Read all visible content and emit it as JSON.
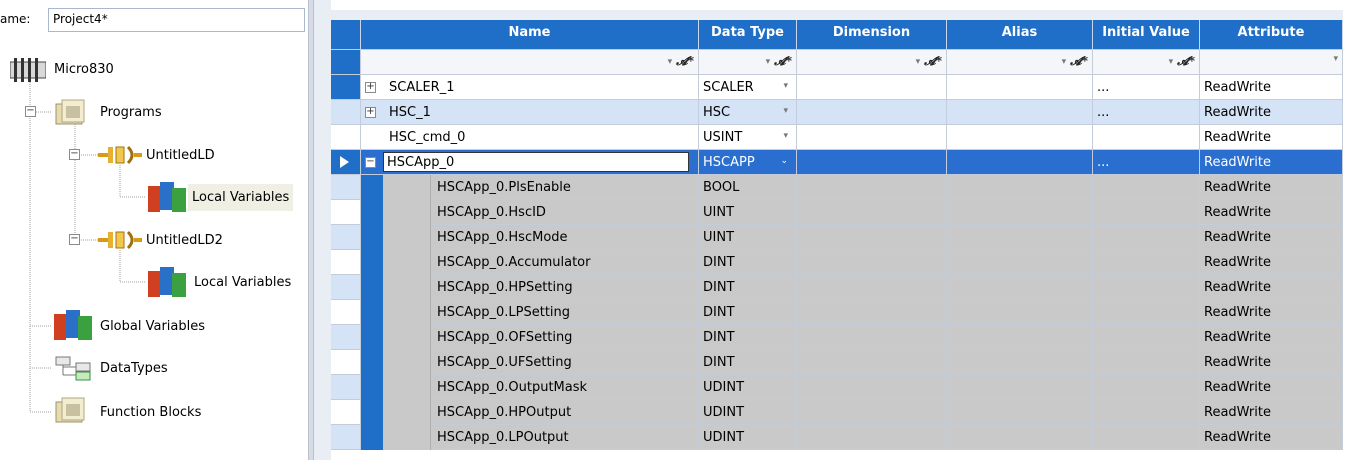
{
  "name_bar": {
    "label": "ame:",
    "value": "Project4*"
  },
  "tree": {
    "controller": "Micro830",
    "programs": "Programs",
    "program1": "UntitledLD",
    "program1_vars": "Local Variables",
    "program2": "UntitledLD2",
    "program2_vars": "Local Variables",
    "global_vars": "Global Variables",
    "datatypes": "DataTypes",
    "function_blocks": "Function Blocks",
    "collapse_symbol": "−"
  },
  "grid": {
    "columns": [
      "Name",
      "Data Type",
      "Dimension",
      "Alias",
      "Initial Value",
      "Attribute"
    ],
    "filter_symbol": "𝓐*",
    "filter_arrow": "▾",
    "rows": [
      {
        "expander": "+",
        "name": "SCALER_1",
        "type": "SCALER",
        "dropdown": "▾",
        "dimension": "",
        "alias": "",
        "initial": "...",
        "attribute": "ReadWrite"
      },
      {
        "expander": "+",
        "name": "HSC_1",
        "type": "HSC",
        "dropdown": "▾",
        "dimension": "",
        "alias": "",
        "initial": "...",
        "attribute": "ReadWrite"
      },
      {
        "expander": "",
        "name": "HSC_cmd_0",
        "type": "USINT",
        "dropdown": "▾",
        "dimension": "",
        "alias": "",
        "initial": "",
        "attribute": "ReadWrite"
      },
      {
        "expander": "−",
        "name": "HSCApp_0",
        "type": "HSCAPP",
        "dropdown": "⌄",
        "dimension": "",
        "alias": "",
        "initial": "...",
        "attribute": "ReadWrite"
      }
    ],
    "members": [
      {
        "name": "HSCApp_0.PlsEnable",
        "type": "BOOL",
        "attribute": "ReadWrite"
      },
      {
        "name": "HSCApp_0.HscID",
        "type": "UINT",
        "attribute": "ReadWrite"
      },
      {
        "name": "HSCApp_0.HscMode",
        "type": "UINT",
        "attribute": "ReadWrite"
      },
      {
        "name": "HSCApp_0.Accumulator",
        "type": "DINT",
        "attribute": "ReadWrite"
      },
      {
        "name": "HSCApp_0.HPSetting",
        "type": "DINT",
        "attribute": "ReadWrite"
      },
      {
        "name": "HSCApp_0.LPSetting",
        "type": "DINT",
        "attribute": "ReadWrite"
      },
      {
        "name": "HSCApp_0.OFSetting",
        "type": "DINT",
        "attribute": "ReadWrite"
      },
      {
        "name": "HSCApp_0.UFSetting",
        "type": "DINT",
        "attribute": "ReadWrite"
      },
      {
        "name": "HSCApp_0.OutputMask",
        "type": "UDINT",
        "attribute": "ReadWrite"
      },
      {
        "name": "HSCApp_0.HPOutput",
        "type": "UDINT",
        "attribute": "ReadWrite"
      },
      {
        "name": "HSCApp_0.LPOutput",
        "type": "UDINT",
        "attribute": "ReadWrite"
      }
    ]
  },
  "colors": {
    "header_blue": "#1f6fc9",
    "selected_row": "#2a6fd0",
    "member_gray": "#c9c9c9"
  }
}
